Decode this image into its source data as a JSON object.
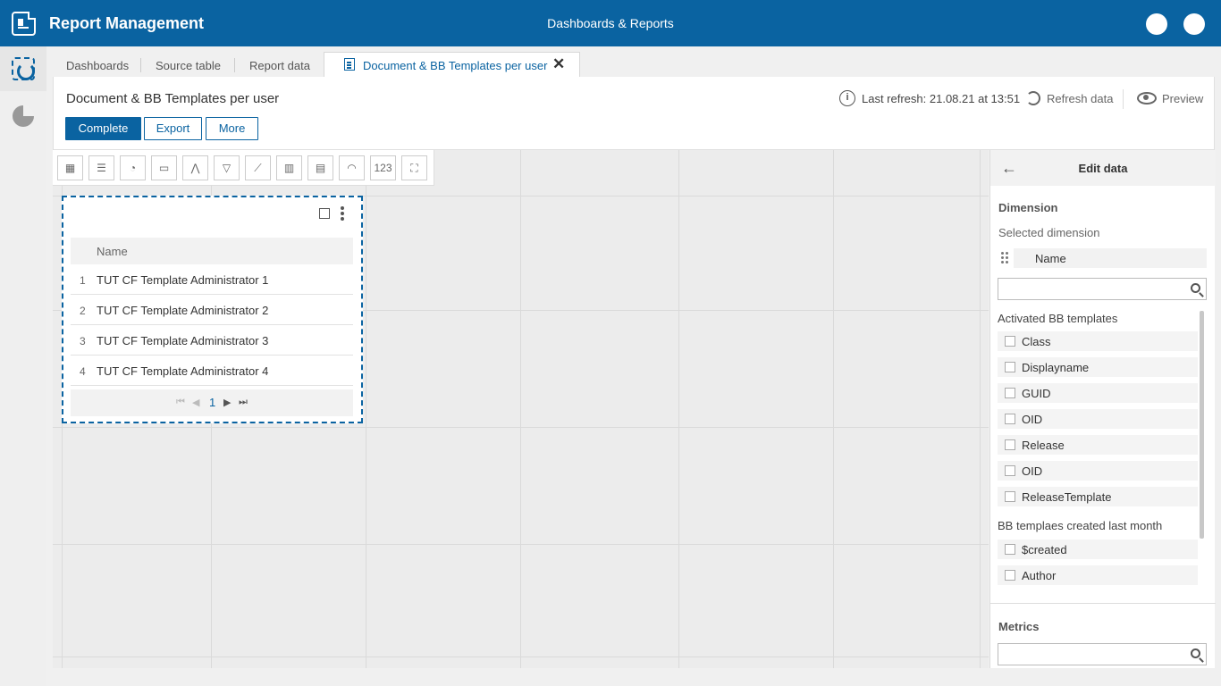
{
  "header": {
    "app_title": "Report Management",
    "center_title": "Dashboards & Reports"
  },
  "tabs": [
    {
      "label": "Dashboards"
    },
    {
      "label": "Source table"
    },
    {
      "label": "Report data"
    },
    {
      "label": "Document & BB Templates per user",
      "active": true
    }
  ],
  "report": {
    "title": "Document & BB Templates per user",
    "buttons": {
      "complete": "Complete",
      "export": "Export",
      "more": "More"
    },
    "last_refresh": "Last refresh: 21.08.21 at 13:51",
    "refresh_label": "Refresh data",
    "preview_label": "Preview"
  },
  "toolbar": {
    "tools": [
      "table-icon",
      "list-icon",
      "pie-chart-icon",
      "calendar-icon",
      "area-chart-icon",
      "funnel-icon",
      "line-chart-icon",
      "bar-chart-icon",
      "stacked-bar-icon",
      "gauge-icon",
      "number-icon",
      "image-icon"
    ],
    "number_label": "123"
  },
  "widget": {
    "column": "Name",
    "rows": [
      {
        "index": "1",
        "value": "TUT CF Template Administrator 1"
      },
      {
        "index": "2",
        "value": "TUT CF Template Administrator 2"
      },
      {
        "index": "3",
        "value": "TUT CF Template Administrator 3"
      },
      {
        "index": "4",
        "value": "TUT CF Template Administrator 4"
      }
    ],
    "page": "1"
  },
  "panel": {
    "title": "Edit data",
    "dimension_heading": "Dimension",
    "selected_dimension_label": "Selected dimension",
    "selected_dimension": "Name",
    "search_placeholder": "",
    "groups": [
      {
        "name": "Activated BB templates",
        "items": [
          "Class",
          "Displayname",
          "GUID",
          "OID",
          "Release",
          "OID",
          "ReleaseTemplate"
        ]
      },
      {
        "name": "BB templaes created last month",
        "items": [
          "$created",
          "Author"
        ]
      }
    ],
    "metrics_heading": "Metrics"
  },
  "colors": {
    "accent": "#0a63a1"
  }
}
